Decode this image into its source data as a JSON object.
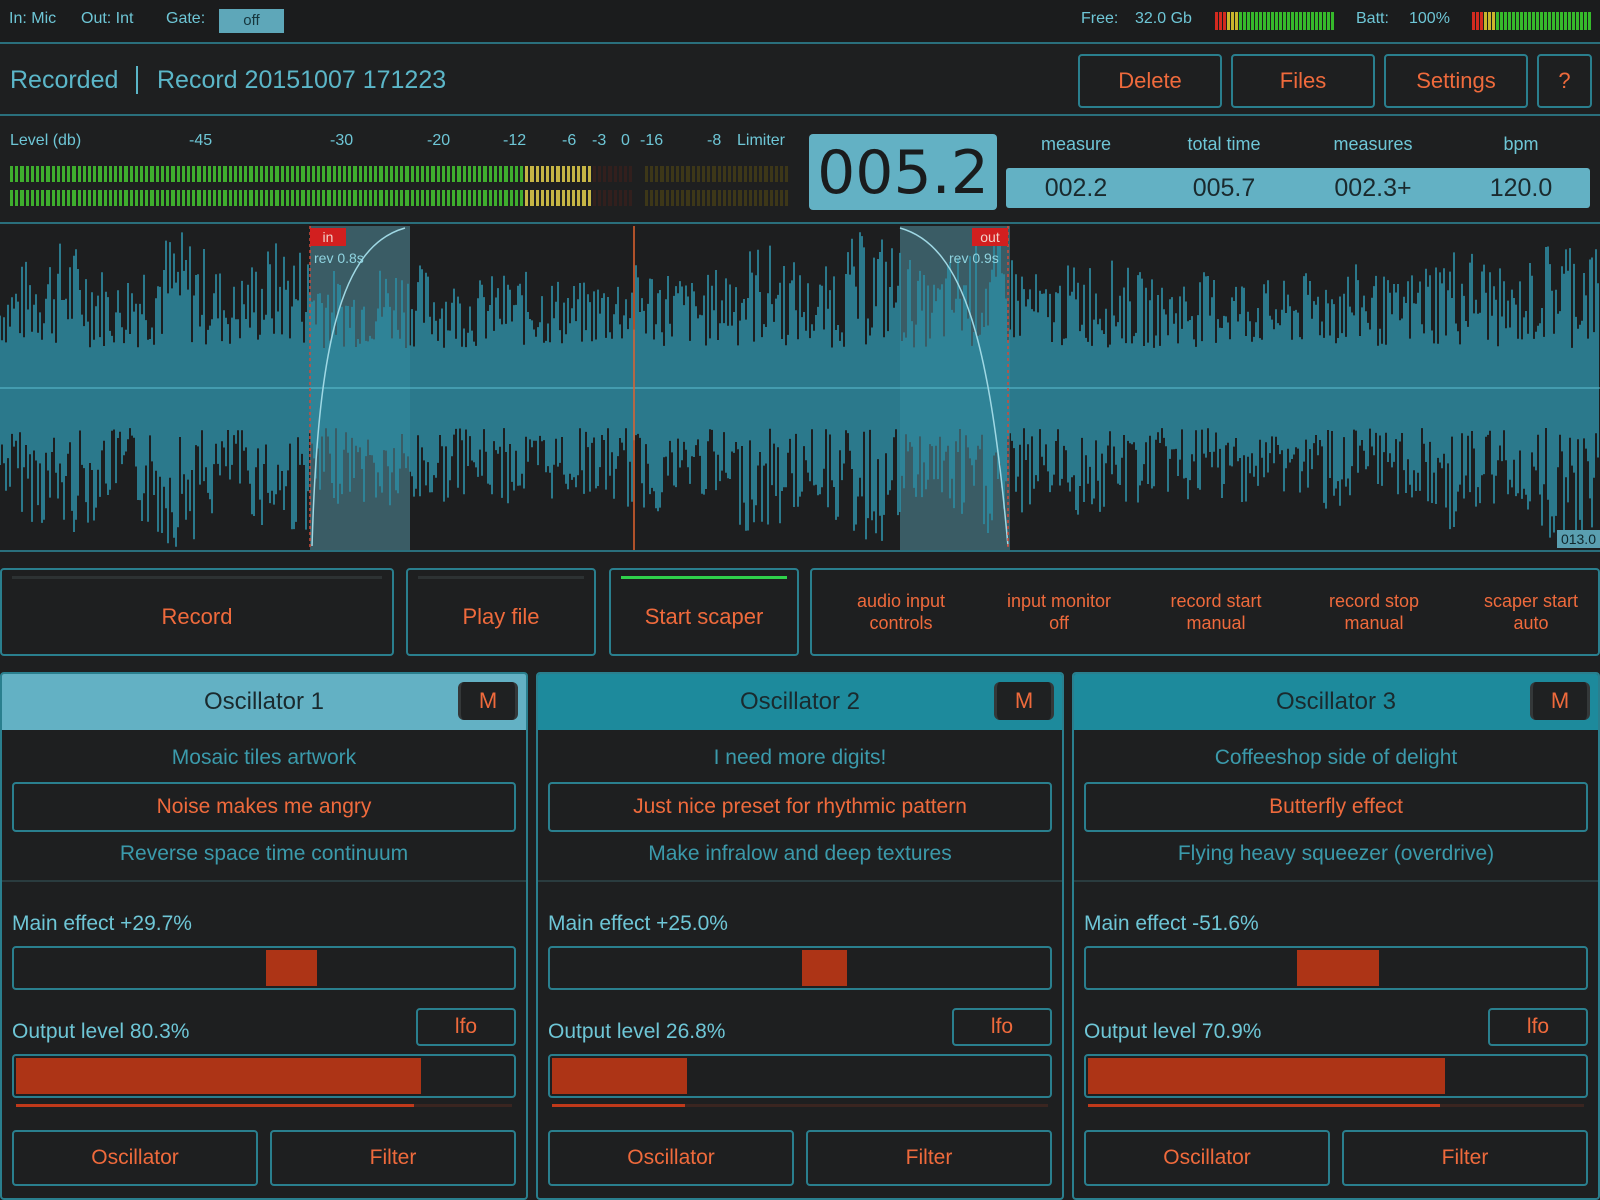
{
  "status": {
    "input": "In: Mic",
    "output": "Out: Int",
    "gate_label": "Gate:",
    "gate_value": "off",
    "free_label": "Free:",
    "free_value": "32.0 Gb",
    "batt_label": "Batt:",
    "batt_value": "100%",
    "free_meter_level": 1.0,
    "batt_meter_level": 1.0
  },
  "header": {
    "status": "Recorded",
    "record_name": "Record 20151007 171223",
    "buttons": {
      "delete": "Delete",
      "files": "Files",
      "settings": "Settings",
      "help": "?"
    }
  },
  "levels": {
    "label": "Level (db)",
    "ticks": [
      "-45",
      "-30",
      "-20",
      "-12",
      "-6",
      "-3",
      "0",
      "-16",
      "-8",
      "Limiter"
    ],
    "channel_1_level": 0.74,
    "channel_2_level": 0.74
  },
  "counter": "005.2",
  "measures": {
    "labels": [
      "measure",
      "total time",
      "measures",
      "bpm"
    ],
    "values": [
      "002.2",
      "005.7",
      "002.3+",
      "120.0"
    ]
  },
  "waveform": {
    "in_marker": "in",
    "out_marker": "out",
    "in_rev": "rev 0.8s",
    "out_rev": "rev 0.9s",
    "end_time": "013.0"
  },
  "transport": {
    "record": "Record",
    "play_file": "Play file",
    "start_scaper": "Start scaper",
    "options": [
      [
        "audio input",
        "controls"
      ],
      [
        "input monitor",
        "off"
      ],
      [
        "record start",
        "manual"
      ],
      [
        "record stop",
        "manual"
      ],
      [
        "scaper start",
        "auto"
      ]
    ]
  },
  "oscillators": [
    {
      "title": "Oscillator 1",
      "mute": "M",
      "preset_prev": "Mosaic tiles artwork",
      "preset_current": "Noise makes me angry",
      "preset_next": "Reverse space time continuum",
      "main_effect_label": "Main effect +29.7%",
      "main_effect": 29.7,
      "output_label": "Output level 80.3%",
      "output_level": 80.3,
      "lfo": "lfo",
      "oscillator_btn": "Oscillator",
      "filter_btn": "Filter",
      "header_color": "#63b1c4"
    },
    {
      "title": "Oscillator 2",
      "mute": "M",
      "preset_prev": "I need more digits!",
      "preset_current": "Just nice preset for rhythmic pattern",
      "preset_next": "Make infralow and deep textures",
      "main_effect_label": "Main effect +25.0%",
      "main_effect": 25.0,
      "output_label": "Output level 26.8%",
      "output_level": 26.8,
      "lfo": "lfo",
      "oscillator_btn": "Oscillator",
      "filter_btn": "Filter",
      "header_color": "#1d8a9c"
    },
    {
      "title": "Oscillator 3",
      "mute": "M",
      "preset_prev": "Coffeeshop side of delight",
      "preset_current": "Butterfly effect",
      "preset_next": "Flying heavy squeezer (overdrive)",
      "main_effect_label": "Main effect -51.6%",
      "main_effect": -51.6,
      "output_label": "Output level 70.9%",
      "output_level": 70.9,
      "lfo": "lfo",
      "oscillator_btn": "Oscillator",
      "filter_btn": "Filter",
      "header_color": "#1d8a9c"
    }
  ],
  "colors": {
    "accent": "#ef6a3c",
    "teal": "#5bb6c8",
    "border": "#2a7f8e",
    "slider_fill": "#ad3416"
  }
}
